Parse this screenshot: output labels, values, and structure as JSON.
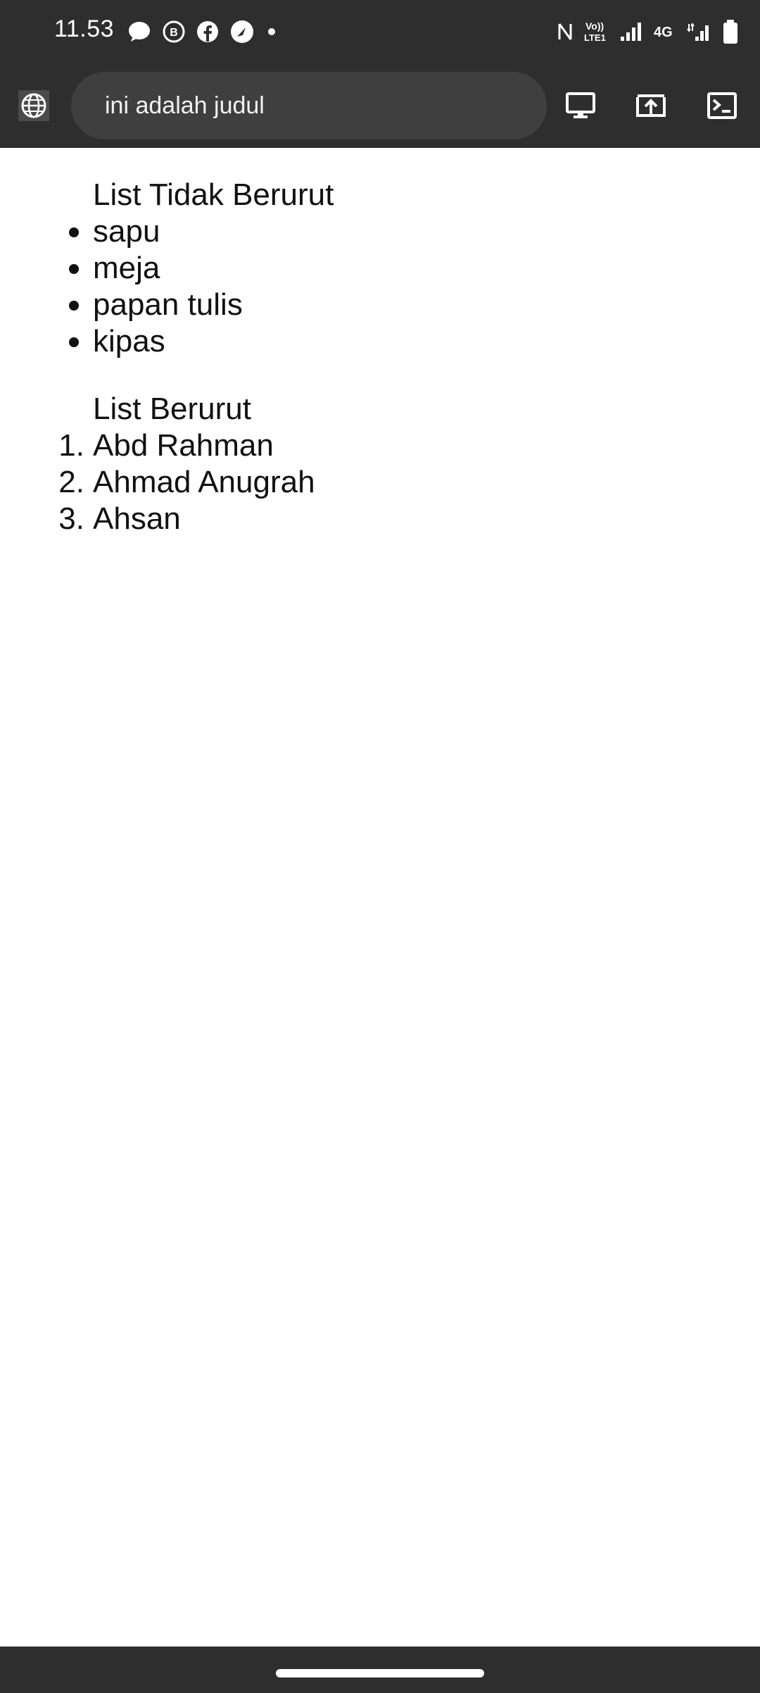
{
  "status_bar": {
    "time": "11.53",
    "left_icons": [
      "message-icon",
      "bbm-icon",
      "facebook-icon",
      "speed-icon",
      "dot-icon"
    ],
    "right_icons": [
      "nfc-icon",
      "volte-icon",
      "signal-icon",
      "4g-icon",
      "signal-icon",
      "battery-icon"
    ],
    "volte_label": "Vo)) LTE1",
    "network_label": "4G"
  },
  "toolbar": {
    "url_text": "ini adalah judul",
    "buttons": [
      "desktop-icon",
      "upload-icon",
      "console-icon"
    ]
  },
  "page": {
    "unordered_caption": "List Tidak Berurut",
    "unordered_items": [
      "sapu",
      "meja",
      "papan tulis",
      "kipas"
    ],
    "ordered_caption": "List Berurut",
    "ordered_items": [
      "Abd Rahman",
      "Ahmad Anugrah",
      "Ahsan"
    ],
    "ordered_markers": [
      "1.",
      "2.",
      "3."
    ]
  }
}
